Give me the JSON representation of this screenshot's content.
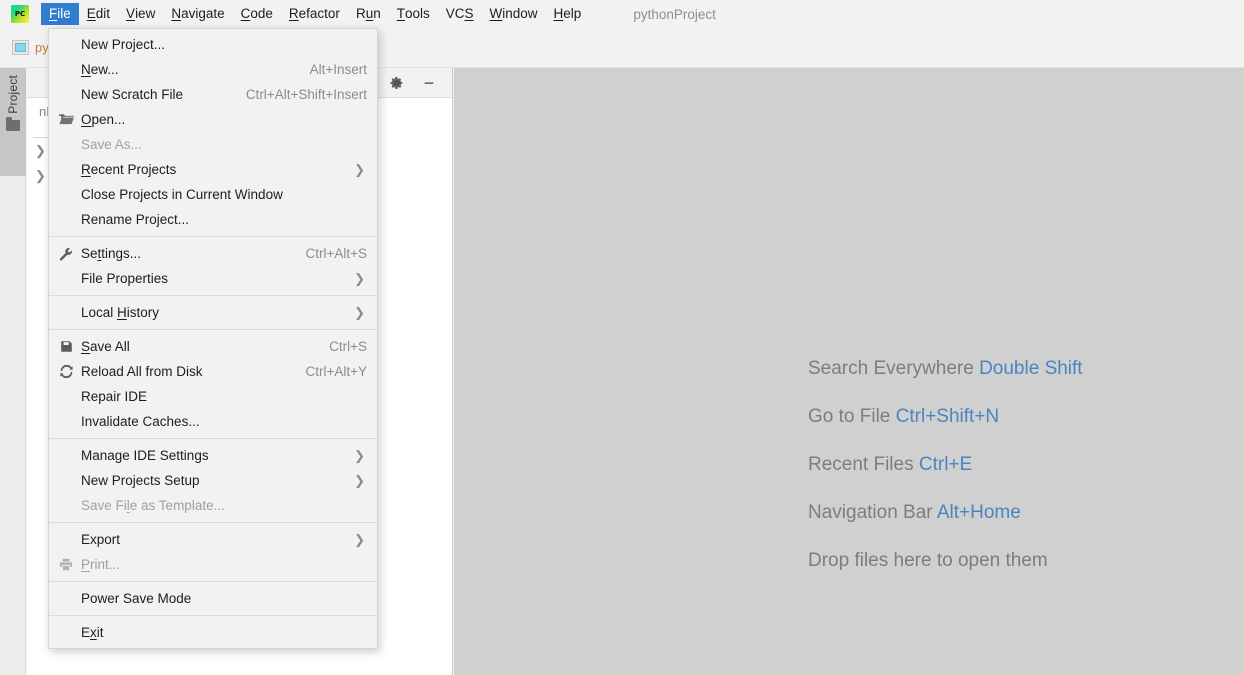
{
  "app": {
    "logo": "pycharm-logo",
    "window_title": "pythonProject"
  },
  "menubar": {
    "items": [
      {
        "label": "File",
        "mnemonic": "F",
        "active": true
      },
      {
        "label": "Edit",
        "mnemonic": "E",
        "active": false
      },
      {
        "label": "View",
        "mnemonic": "V",
        "active": false
      },
      {
        "label": "Navigate",
        "mnemonic": "N",
        "active": false
      },
      {
        "label": "Code",
        "mnemonic": "C",
        "active": false
      },
      {
        "label": "Refactor",
        "mnemonic": "R",
        "active": false
      },
      {
        "label": "Run",
        "mnemonic": "u",
        "active": false
      },
      {
        "label": "Tools",
        "mnemonic": "T",
        "active": false
      },
      {
        "label": "VCS",
        "mnemonic": "S",
        "active": false
      },
      {
        "label": "Window",
        "mnemonic": "W",
        "active": false
      },
      {
        "label": "Help",
        "mnemonic": "H",
        "active": false
      }
    ]
  },
  "breadcrumb": {
    "project_name": "py"
  },
  "toolwindow": {
    "stripe_label": "Project",
    "title": "nProject",
    "gear_icon": "gear-icon",
    "minimize_icon": "minimize-icon"
  },
  "file_menu": {
    "groups": [
      {
        "items": [
          {
            "label": "New Project...",
            "shortcut": "",
            "icon": "",
            "arrow": false,
            "disabled": false
          },
          {
            "label": "New...",
            "mnemonic": "N",
            "shortcut": "Alt+Insert",
            "icon": "",
            "arrow": false,
            "disabled": false
          },
          {
            "label": "New Scratch File",
            "shortcut": "Ctrl+Alt+Shift+Insert",
            "icon": "",
            "arrow": false,
            "disabled": false
          },
          {
            "label": "Open...",
            "mnemonic": "O",
            "shortcut": "",
            "icon": "folder-icon",
            "arrow": false,
            "disabled": false
          },
          {
            "label": "Save As...",
            "shortcut": "",
            "icon": "",
            "arrow": false,
            "disabled": true
          },
          {
            "label": "Recent Projects",
            "mnemonic": "R",
            "shortcut": "",
            "icon": "",
            "arrow": true,
            "disabled": false
          },
          {
            "label": "Close Projects in Current Window",
            "shortcut": "",
            "icon": "",
            "arrow": false,
            "disabled": false
          },
          {
            "label": "Rename Project...",
            "shortcut": "",
            "icon": "",
            "arrow": false,
            "disabled": false
          }
        ]
      },
      {
        "items": [
          {
            "label": "Settings...",
            "mnemonic": "t",
            "shortcut": "Ctrl+Alt+S",
            "icon": "wrench-icon",
            "arrow": false,
            "disabled": false
          },
          {
            "label": "File Properties",
            "shortcut": "",
            "icon": "",
            "arrow": true,
            "disabled": false
          }
        ]
      },
      {
        "items": [
          {
            "label": "Local History",
            "mnemonic": "H",
            "shortcut": "",
            "icon": "",
            "arrow": true,
            "disabled": false
          }
        ]
      },
      {
        "items": [
          {
            "label": "Save All",
            "mnemonic": "S",
            "shortcut": "Ctrl+S",
            "icon": "save-icon",
            "arrow": false,
            "disabled": false
          },
          {
            "label": "Reload All from Disk",
            "shortcut": "Ctrl+Alt+Y",
            "icon": "reload-icon",
            "arrow": false,
            "disabled": false
          },
          {
            "label": "Repair IDE",
            "shortcut": "",
            "icon": "",
            "arrow": false,
            "disabled": false
          },
          {
            "label": "Invalidate Caches...",
            "shortcut": "",
            "icon": "",
            "arrow": false,
            "disabled": false
          }
        ]
      },
      {
        "items": [
          {
            "label": "Manage IDE Settings",
            "shortcut": "",
            "icon": "",
            "arrow": true,
            "disabled": false
          },
          {
            "label": "New Projects Setup",
            "shortcut": "",
            "icon": "",
            "arrow": true,
            "disabled": false
          },
          {
            "label": "Save File as Template...",
            "mnemonic": "l",
            "shortcut": "",
            "icon": "",
            "arrow": false,
            "disabled": true
          }
        ]
      },
      {
        "items": [
          {
            "label": "Export",
            "shortcut": "",
            "icon": "",
            "arrow": true,
            "disabled": false
          },
          {
            "label": "Print...",
            "mnemonic": "P",
            "shortcut": "",
            "icon": "print-icon",
            "arrow": false,
            "disabled": true
          }
        ]
      },
      {
        "items": [
          {
            "label": "Power Save Mode",
            "shortcut": "",
            "icon": "",
            "arrow": false,
            "disabled": false
          }
        ]
      },
      {
        "items": [
          {
            "label": "Exit",
            "mnemonic": "x",
            "shortcut": "",
            "icon": "",
            "arrow": false,
            "disabled": false
          }
        ]
      }
    ]
  },
  "editor_hints": {
    "items": [
      {
        "text": "Search Everywhere ",
        "key": "Double Shift"
      },
      {
        "text": "Go to File ",
        "key": "Ctrl+Shift+N"
      },
      {
        "text": "Recent Files ",
        "key": "Ctrl+E"
      },
      {
        "text": "Navigation Bar ",
        "key": "Alt+Home"
      },
      {
        "text": "Drop files here to open them",
        "key": ""
      }
    ]
  },
  "colors": {
    "menu_accent": "#2f7cd0",
    "hint_key": "#4b84c4",
    "editor_bg": "#d0d0d0",
    "menu_bg": "#f2f2f2"
  }
}
